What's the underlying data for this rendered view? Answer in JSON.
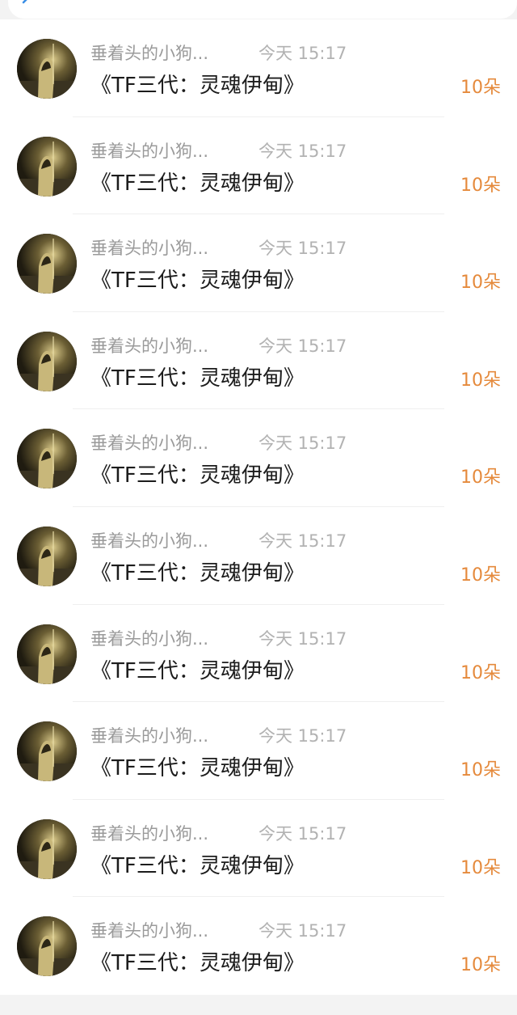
{
  "icons": {
    "back": "chevron-left-icon",
    "avatar": "avatar-image"
  },
  "colors": {
    "gift": "#e58a3c",
    "name": "#9a9a9a",
    "time": "#b2b2b2",
    "title": "#1c1c1c"
  },
  "items": [
    {
      "name": "垂着头的小狗...",
      "time": "今天 15:17",
      "title": "《TF三代：灵魂伊甸》",
      "gift": "10朵"
    },
    {
      "name": "垂着头的小狗...",
      "time": "今天 15:17",
      "title": "《TF三代：灵魂伊甸》",
      "gift": "10朵"
    },
    {
      "name": "垂着头的小狗...",
      "time": "今天 15:17",
      "title": "《TF三代：灵魂伊甸》",
      "gift": "10朵"
    },
    {
      "name": "垂着头的小狗...",
      "time": "今天 15:17",
      "title": "《TF三代：灵魂伊甸》",
      "gift": "10朵"
    },
    {
      "name": "垂着头的小狗...",
      "time": "今天 15:17",
      "title": "《TF三代：灵魂伊甸》",
      "gift": "10朵"
    },
    {
      "name": "垂着头的小狗...",
      "time": "今天 15:17",
      "title": "《TF三代：灵魂伊甸》",
      "gift": "10朵"
    },
    {
      "name": "垂着头的小狗...",
      "time": "今天 15:17",
      "title": "《TF三代：灵魂伊甸》",
      "gift": "10朵"
    },
    {
      "name": "垂着头的小狗...",
      "time": "今天 15:17",
      "title": "《TF三代：灵魂伊甸》",
      "gift": "10朵"
    },
    {
      "name": "垂着头的小狗...",
      "time": "今天 15:17",
      "title": "《TF三代：灵魂伊甸》",
      "gift": "10朵"
    },
    {
      "name": "垂着头的小狗...",
      "time": "今天 15:17",
      "title": "《TF三代：灵魂伊甸》",
      "gift": "10朵"
    }
  ]
}
